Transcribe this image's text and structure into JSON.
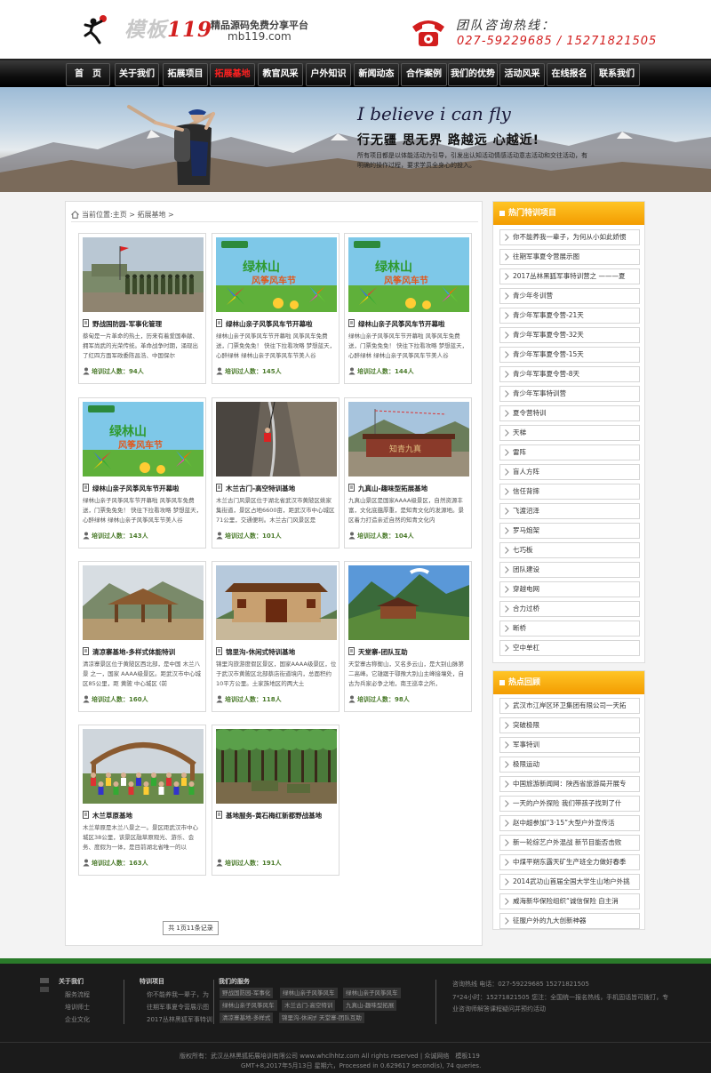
{
  "header": {
    "logo_title_a": "模板",
    "logo_title_b": "119",
    "logo_tagline": "精品源码免费分享平台",
    "logo_url": "mb119.com",
    "hotline_title": "团队咨询热线：",
    "hotline_numbers": "027-59229685 / 15271821505"
  },
  "nav": {
    "items": [
      "首　页",
      "关于我们",
      "拓展项目",
      "拓展基地",
      "教官风采",
      "户外知识",
      "新闻动态",
      "合作案例",
      "我们的优势",
      "活动风采",
      "在线报名",
      "联系我们"
    ],
    "active_index": 3
  },
  "banner": {
    "slogan_en": "I believe i can fly",
    "slogan_cn": "行无疆 思无界 路越远 心越近!",
    "description": "所有项目都是以体能活动为引导，引发出认知活动情感活动意志活动和交往活动，有明确的操作过程，要求学员全身心的投入。"
  },
  "breadcrumb": {
    "text": "当前位置:主页 > 拓展基地 >"
  },
  "cards": [
    {
      "title": "野战国防园-军事化管理",
      "desc": "蔡甸是一片革命的热土，历来有着爱国奉献、拥军尚武的光荣传统。革命战争时期，涌现出了红四方面军政委陈昌浩、中国保尔",
      "trained": "培训过人数：94人",
      "img": "military"
    },
    {
      "title": "绿林山亲子风筝风车节开幕啦",
      "desc": "绿林山亲子风筝风车节开幕啦 风筝风车免费送，门票免免免！ 快往下拉看攻略 梦想蓝天，心醉绿林 绿林山亲子风筝风车节美人谷",
      "trained": "培训过人数：145人",
      "img": "kite"
    },
    {
      "title": "绿林山亲子风筝风车节开幕啦",
      "desc": "绿林山亲子风筝风车节开幕啦 风筝风车免费送，门票免免免！ 快往下拉看攻略 梦想蓝天，心醉绿林 绿林山亲子风筝风车节美人谷",
      "trained": "培训过人数：144人",
      "img": "kite"
    },
    {
      "title": "绿林山亲子风筝风车节开幕啦",
      "desc": "绿林山亲子风筝风车节开幕啦 风筝风车免费送，门票免免免！ 快往下拉看攻略 梦想蓝天，心醉绿林 绿林山亲子风筝风车节美人谷",
      "trained": "培训过人数：143人",
      "img": "kite"
    },
    {
      "title": "木兰古门-高空特训基地",
      "desc": "木兰古门风景区位于湖北省武汉市黄陂区姚家集街道，景区占地6600亩，距武汉市中心城区71公里，交通便利。木兰古门风景区是",
      "trained": "培训过人数：101人",
      "img": "climb"
    },
    {
      "title": "九真山-趣味型拓展基地",
      "desc": "九真山景区是国家AAAA级景区，自然资源丰富，文化底蕴厚重，是知青文化的发源地。景区着力打造亲近自然的知青文化内",
      "trained": "培训过人数：104人",
      "img": "gate"
    },
    {
      "title": "清凉寨基地-多样式体能特训",
      "desc": "清凉寨景区位于黄陂区西北部，是中国 木兰八景 之一，国家 AAAA级景区。距武汉市中心城区85公里，距 黄陂 中心城区 (前",
      "trained": "培训过人数：160人",
      "img": "pavilion"
    },
    {
      "title": "锦里沟-休闲式特训基地",
      "desc": "锦里沟旅游度假区景区，国家AAAA级景区，位于武汉市黄陂区北部蔡店街道境内，总面积约10平方公里。土家族地区的两大土",
      "trained": "培训过人数：118人",
      "img": "palace"
    },
    {
      "title": "天堂寨-团队互助",
      "desc": "天堂寨古称衡山，又名多云山，是大别山脉第二高峰。它雄踞于鄂豫大别山主峰接壤处，自古为兵家必争之地，南王巡幸之所，",
      "trained": "培训过人数：98人",
      "img": "mountain"
    },
    {
      "title": "木兰草原基地",
      "desc": "木兰草原是木兰八景之一。景区距武汉市中心城区38公里，该景区融草原观光、游乐、会务、度假为一体，是目前湖北省唯一的以",
      "trained": "培训过人数：163人",
      "img": "group"
    },
    {
      "title": "基地服务-黄石梅红新都野战基地",
      "desc": "",
      "trained": "培训过人数：191人",
      "img": "forest"
    }
  ],
  "pager": {
    "text": "共 1页11条记录"
  },
  "sidebar": {
    "hot_title": "热门特训项目",
    "hot_items": [
      "你不能养我一辈子，为何从小如此娇惯",
      "往期军事夏令营展示图",
      "2017丛林黑狐军事特训营之 ———夏",
      "青少年冬训营",
      "青少年军事夏令营-21天",
      "青少年军事夏令营-32天",
      "青少年军事夏令营-15天",
      "青少年军事夏令营-8天",
      "青少年军事特训营",
      "夏令营特训",
      "天梯",
      "雷阵",
      "盲人方阵",
      "信任背摔",
      "飞渡沼泽",
      "罗马炮架",
      "七巧板",
      "团队建设",
      "穿越电网",
      "合力过桥",
      "断桥",
      "空中单杠"
    ],
    "news_title": "热点回顾",
    "news_items": [
      "武汉市江岸区环卫集团有限公司一天拓",
      "突破极限",
      "军事特训",
      "极限运动",
      "中国旅游新闻网：陕西省旅游局开展专",
      "一天的户外探险 我们带孩子找到了什",
      "赵中超参加“3·15”大型户外宣传活",
      "新一轮综艺户外混战 新节目能否击败",
      "中煤平朔东露天矿生产班全力做好春季",
      "2014武功山首届全国大学生山地户外挑",
      "威海新华保险组织“诚信保险 自主消",
      "征服户外的九大创新神器"
    ]
  },
  "footer": {
    "col1_title": "关于我们",
    "col1_links": [
      "服务流程",
      "培训师士",
      "企业文化"
    ],
    "col2_title": "特训项目",
    "col2_links": [
      "你不能养我一辈子，为",
      "往期军事夏令营展示图",
      "2017丛林黑狐军事特训"
    ],
    "col3_title": "我们的服务",
    "col3_tags": [
      "野战国防园-军事化",
      "绿林山亲子风筝风车",
      "绿林山亲子风筝风车",
      "绿林山亲子风筝风车",
      "木兰古门-高空特训",
      "九真山-趣味型拓展",
      "清凉寨基地-多样式",
      "锦里沟-休闲式特训",
      "天堂寨-团队互助"
    ],
    "contact_line1": "咨询热线 电话：027-59229685 15271821505",
    "contact_line2": "7*24小时：15271821505 您注：全国统一报名热线，手机固话皆可拨打，专",
    "contact_line3": "业咨询师解答课程疑问并预约活动",
    "copyright": "版权所有：武汉丛林黑狐拓展培训有限公司 www.whclhhtz.com All rights reserved | 众诚网络　模板119",
    "stats": "GMT+8,2017年5月13日 星期六，Processed in 0.629617 second(s), 74 queries."
  },
  "colors": {
    "accent": "#d21e1e",
    "side_head": "#f39c00",
    "footer_stripe": "#2a7a2a"
  }
}
